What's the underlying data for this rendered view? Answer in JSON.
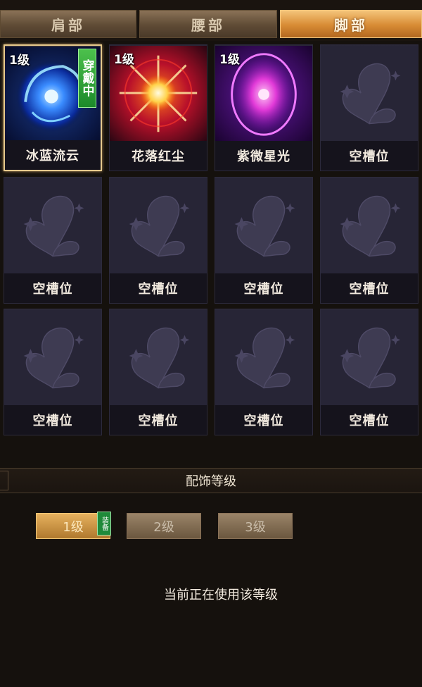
{
  "tabs": [
    {
      "label": "肩部",
      "active": false
    },
    {
      "label": "腰部",
      "active": false
    },
    {
      "label": "脚部",
      "active": true
    }
  ],
  "slots": [
    {
      "level": "1级",
      "name": "冰蓝流云",
      "icon": "blue-swirl-orb",
      "equipped": true,
      "badge": "穿戴中"
    },
    {
      "level": "1级",
      "name": "花落红尘",
      "icon": "red-starburst",
      "equipped": false
    },
    {
      "level": "1级",
      "name": "紫微星光",
      "icon": "purple-glow-ring",
      "equipped": false
    },
    {
      "name": "空槽位",
      "icon": "butterfly-placeholder"
    },
    {
      "name": "空槽位",
      "icon": "butterfly-placeholder"
    },
    {
      "name": "空槽位",
      "icon": "butterfly-placeholder"
    },
    {
      "name": "空槽位",
      "icon": "butterfly-placeholder"
    },
    {
      "name": "空槽位",
      "icon": "butterfly-placeholder"
    },
    {
      "name": "空槽位",
      "icon": "butterfly-placeholder"
    },
    {
      "name": "空槽位",
      "icon": "butterfly-placeholder"
    },
    {
      "name": "空槽位",
      "icon": "butterfly-placeholder"
    },
    {
      "name": "空槽位",
      "icon": "butterfly-placeholder"
    }
  ],
  "section": {
    "title": "配饰等级"
  },
  "level_buttons": [
    {
      "label": "1级",
      "active": true,
      "tag": "装备"
    },
    {
      "label": "2级",
      "active": false
    },
    {
      "label": "3级",
      "active": false
    }
  ],
  "status": {
    "text": "当前正在使用该等级"
  },
  "colors": {
    "accent_gold": "#e6b15e",
    "badge_green": "#1f8a3a",
    "slot_bg": "#25232f"
  }
}
